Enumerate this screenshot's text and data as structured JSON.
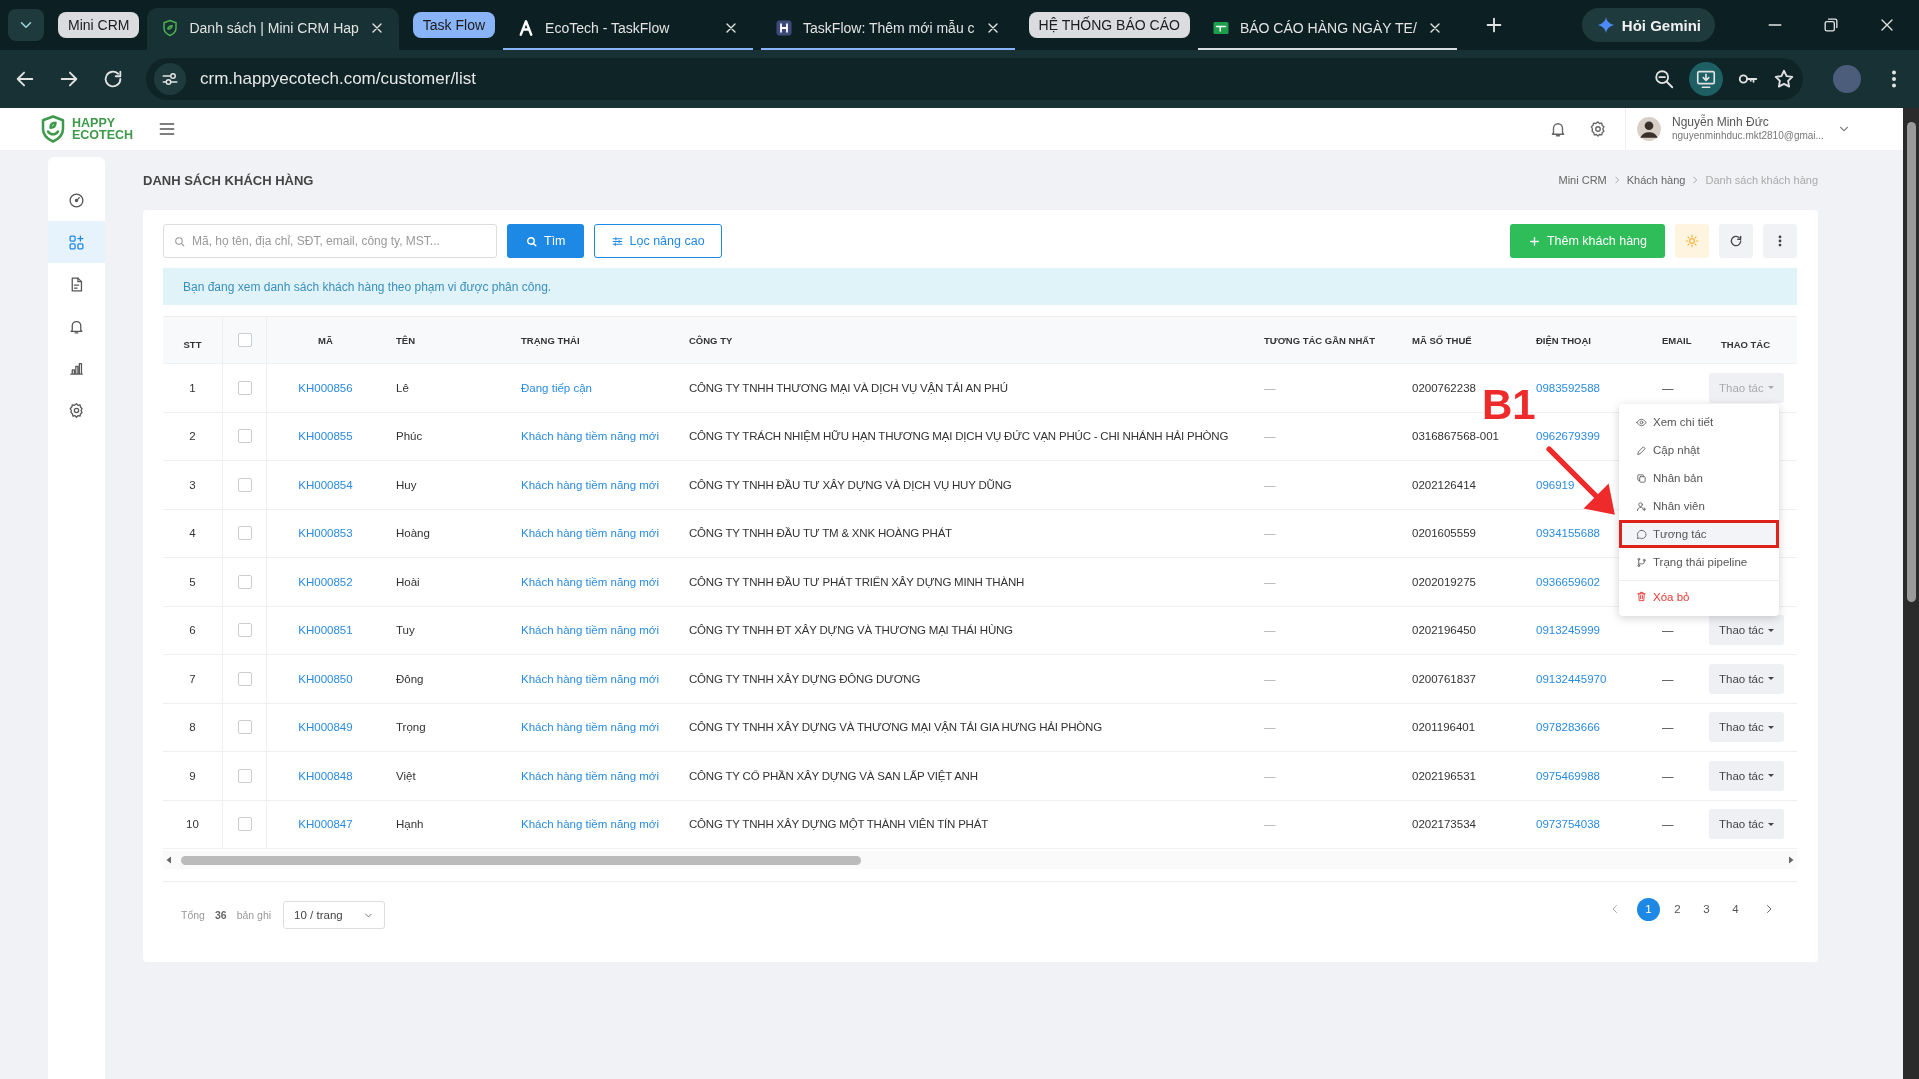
{
  "browser": {
    "tabs": [
      {
        "kind": "group",
        "label": "Mini CRM",
        "color": "#dadce0"
      },
      {
        "kind": "tab",
        "title": "Danh sách | Mini CRM Hap",
        "selected": true
      },
      {
        "kind": "group",
        "label": "Task Flow",
        "color": "#8ab4f8"
      },
      {
        "kind": "tab",
        "title": "EcoTech - TaskFlow",
        "selected": false
      },
      {
        "kind": "tab",
        "title": "TaskFlow: Thêm mới mẫu c",
        "selected": false
      },
      {
        "kind": "group",
        "label": "HỆ THỐNG BÁO CÁO",
        "color": "#dadce0"
      },
      {
        "kind": "tab",
        "title": "BÁO CÁO HÀNG NGÀY TE/",
        "selected": false
      }
    ],
    "gemini": "Hỏi Gemini",
    "url": "crm.happyecotech.com/customer/list"
  },
  "header": {
    "logo_top": "HAPPY",
    "logo_bottom": "ECOTECH",
    "user_name": "Nguyễn Minh Đức",
    "user_email": "nguyenminhduc.mkt2810@gmai..."
  },
  "sidebar": {
    "items": [
      {
        "selected": false
      },
      {
        "selected": true
      },
      {
        "selected": false
      },
      {
        "selected": false
      },
      {
        "selected": false
      },
      {
        "selected": false
      }
    ]
  },
  "page": {
    "title": "DANH SÁCH KHÁCH HÀNG",
    "breadcrumb": [
      {
        "label": "Mini CRM",
        "current": false
      },
      {
        "label": "Khách hàng",
        "current": false
      },
      {
        "label": "Danh sách khách hàng",
        "current": true
      }
    ]
  },
  "toolbar": {
    "search_placeholder": "Mã, họ tên, địa chỉ, SĐT, email, công ty, MST...",
    "search_button": "Tìm",
    "filter_button": "Lọc nâng cao",
    "add_button": "Thêm khách hàng"
  },
  "notice": "Bạn đang xem danh sách khách hàng theo phạm vi được phân công.",
  "table": {
    "columns": [
      "STT",
      "MÃ",
      "TÊN",
      "TRẠNG THÁI",
      "CÔNG TY",
      "TƯƠNG TÁC GẦN NHẤT",
      "MÃ SỐ THUẾ",
      "ĐIỆN THOẠI",
      "EMAIL",
      "THAO TÁC"
    ],
    "header_checked": false,
    "rows": [
      {
        "stt": "1",
        "checked": false,
        "code": "KH000856",
        "name": "Lê",
        "status": "Đang tiếp cận",
        "company": "CÔNG TY TNHH THƯƠNG MẠI VÀ DỊCH VỤ VẬN TẢI AN PHÚ",
        "last_interaction": "—",
        "tax_code": "0200762238",
        "phone": "0983592588",
        "email": "—",
        "action": {
          "label": "Thao tác",
          "open": true
        }
      },
      {
        "stt": "2",
        "checked": false,
        "code": "KH000855",
        "name": "Phúc",
        "status": "Khách hàng tiềm năng mới",
        "company": "CÔNG TY TRÁCH NHIỆM HỮU HẠN THƯƠNG MẠI DỊCH VỤ ĐỨC VẠN PHÚC - CHI NHÁNH HẢI PHÒNG",
        "last_interaction": "—",
        "tax_code": "0316867568-001",
        "phone": "0962679399"
      },
      {
        "stt": "3",
        "checked": false,
        "code": "KH000854",
        "name": "Huy",
        "status": "Khách hàng tiềm năng mới",
        "company": "CÔNG TY TNHH ĐẦU TƯ XÂY DỰNG VÀ DỊCH VỤ HUY DŨNG",
        "last_interaction": "—",
        "tax_code": "0202126414",
        "phone": "096919"
      },
      {
        "stt": "4",
        "checked": false,
        "code": "KH000853",
        "name": "Hoàng",
        "status": "Khách hàng tiềm năng mới",
        "company": "CÔNG TY TNHH ĐẦU TƯ TM & XNK HOÀNG PHÁT",
        "last_interaction": "—",
        "tax_code": "0201605559",
        "phone": "0934155688"
      },
      {
        "stt": "5",
        "checked": false,
        "code": "KH000852",
        "name": "Hoài",
        "status": "Khách hàng tiềm năng mới",
        "company": "CÔNG TY TNHH ĐẦU TƯ PHÁT TRIỂN XÂY DỰNG MINH THÀNH",
        "last_interaction": "—",
        "tax_code": "0202019275",
        "phone": "0936659602"
      },
      {
        "stt": "6",
        "checked": false,
        "code": "KH000851",
        "name": "Tuy",
        "status": "Khách hàng tiềm năng mới",
        "company": "CÔNG TY TNHH ĐT XÂY DỰNG VÀ THƯƠNG MẠI THÁI HÙNG",
        "last_interaction": "—",
        "tax_code": "0202196450",
        "phone": "0913245999",
        "email": "—",
        "action": {
          "label": "Thao tác",
          "open": false
        }
      },
      {
        "stt": "7",
        "checked": false,
        "code": "KH000850",
        "name": "Đông",
        "status": "Khách hàng tiềm năng mới",
        "company": "CÔNG TY TNHH XÂY DỰNG ĐÔNG DƯƠNG",
        "last_interaction": "—",
        "tax_code": "0200761837",
        "phone": "09132445970",
        "email": "—",
        "action": {
          "label": "Thao tác",
          "open": false
        }
      },
      {
        "stt": "8",
        "checked": false,
        "code": "KH000849",
        "name": "Trọng",
        "status": "Khách hàng tiềm năng mới",
        "company": "CÔNG TY TNHH XÂY DỰNG VÀ THƯƠNG MẠI VẬN TẢI GIA HƯNG HẢI PHÒNG",
        "last_interaction": "—",
        "tax_code": "0201196401",
        "phone": "0978283666",
        "email": "—",
        "action": {
          "label": "Thao tác",
          "open": false
        }
      },
      {
        "stt": "9",
        "checked": false,
        "code": "KH000848",
        "name": "Việt",
        "status": "Khách hàng tiềm năng mới",
        "company": "CÔNG TY CỔ PHẦN XÂY DỰNG VÀ SAN LẤP VIỆT ANH",
        "last_interaction": "—",
        "tax_code": "0202196531",
        "phone": "0975469988",
        "email": "—",
        "action": {
          "label": "Thao tác",
          "open": false
        }
      },
      {
        "stt": "10",
        "checked": false,
        "code": "KH000847",
        "name": "Hạnh",
        "status": "Khách hàng tiềm năng mới",
        "company": "CÔNG TY TNHH XÂY DỰNG MỘT THÀNH VIÊN TÍN PHÁT",
        "last_interaction": "—",
        "tax_code": "0202173534",
        "phone": "0973754038",
        "email": "—",
        "action": {
          "label": "Thao tác",
          "open": false
        }
      }
    ]
  },
  "action_menu": {
    "items": [
      {
        "kind": "item",
        "label": "Xem chi tiết",
        "highlighted": false
      },
      {
        "kind": "item",
        "label": "Cập nhật",
        "highlighted": false
      },
      {
        "kind": "item",
        "label": "Nhân bản",
        "highlighted": false
      },
      {
        "kind": "item",
        "label": "Nhân viên",
        "highlighted": false
      },
      {
        "kind": "item",
        "label": "Tương tác",
        "highlighted": true
      },
      {
        "kind": "item",
        "label": "Trạng thái pipeline",
        "highlighted": false
      },
      {
        "kind": "danger",
        "label": "Xóa bỏ",
        "highlighted": false
      }
    ]
  },
  "annotation": {
    "label": "B1"
  },
  "pagination": {
    "total_label": "Tổng",
    "total": "36",
    "unit": "bản ghi",
    "page_size": "10 / trang",
    "pages": [
      {
        "label": "1",
        "selected": true
      },
      {
        "label": "2",
        "selected": false
      },
      {
        "label": "3",
        "selected": false
      },
      {
        "label": "4",
        "selected": false
      }
    ]
  }
}
